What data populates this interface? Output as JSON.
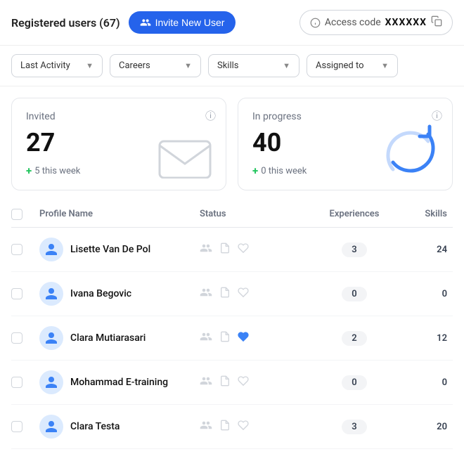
{
  "header": {
    "title": "Registered users (67)",
    "invite_label": "Invite New User",
    "access_code_label": "Access code",
    "access_code_value": "XXXXXX"
  },
  "filters": [
    {
      "id": "last-activity",
      "label": "Last Activity"
    },
    {
      "id": "careers",
      "label": "Careers"
    },
    {
      "id": "skills",
      "label": "Skills"
    },
    {
      "id": "assigned-to",
      "label": "Assigned to"
    }
  ],
  "stats": [
    {
      "id": "invited",
      "label": "Invited",
      "number": "27",
      "sub": "5 this week",
      "icon": "envelope"
    },
    {
      "id": "in-progress",
      "label": "In progress",
      "number": "40",
      "sub": "0 this week",
      "icon": "refresh"
    }
  ],
  "table": {
    "columns": [
      "",
      "Profile Name",
      "Status",
      "Experiences",
      "Skills"
    ],
    "rows": [
      {
        "name": "Lisette Van De Pol",
        "status_icons": [
          "person",
          "file",
          "heart"
        ],
        "active_icon": -1,
        "experiences": 3,
        "skills": 24
      },
      {
        "name": "Ivana Begovic",
        "status_icons": [
          "person",
          "file",
          "heart"
        ],
        "active_icon": -1,
        "experiences": 0,
        "skills": 0
      },
      {
        "name": "Clara Mutiarasari",
        "status_icons": [
          "person",
          "file",
          "heart"
        ],
        "active_icon": 2,
        "experiences": 2,
        "skills": 12
      },
      {
        "name": "Mohammad E-training",
        "status_icons": [
          "person",
          "file",
          "heart"
        ],
        "active_icon": -1,
        "experiences": 0,
        "skills": 0
      },
      {
        "name": "Clara Testa",
        "status_icons": [
          "person",
          "file",
          "heart"
        ],
        "active_icon": -1,
        "experiences": 3,
        "skills": 20
      }
    ]
  },
  "colors": {
    "accent": "#2563eb",
    "avatar_bg": "#dbeafe",
    "avatar_icon": "#60a5fa",
    "refresh_blue": "#3b82f6"
  }
}
